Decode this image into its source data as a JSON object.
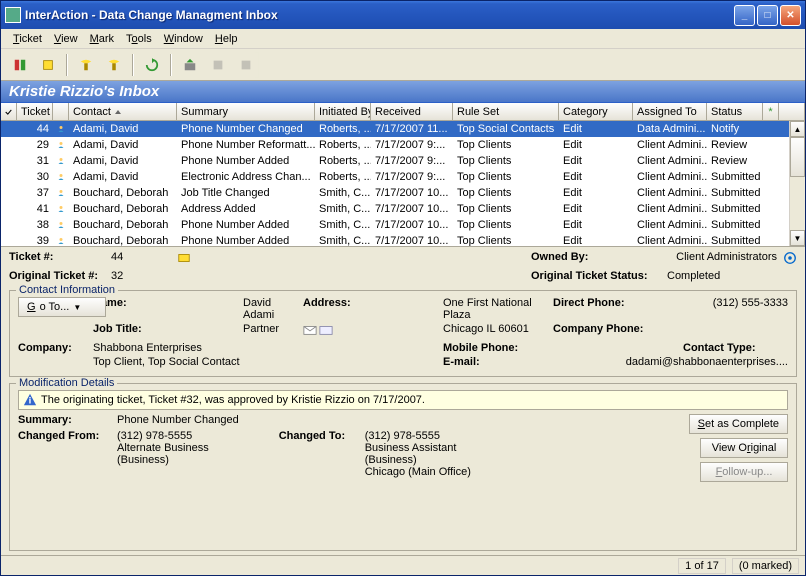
{
  "window": {
    "title": "InterAction - Data Change Managment Inbox"
  },
  "menu": [
    "Ticket",
    "View",
    "Mark",
    "Tools",
    "Window",
    "Help"
  ],
  "inbox_title": "Kristie Rizzio's Inbox",
  "columns": {
    "ticket": "Ticket",
    "contact": "Contact",
    "summary": "Summary",
    "initiated": "Initiated By",
    "received": "Received",
    "ruleset": "Rule Set",
    "category": "Category",
    "assigned": "Assigned To",
    "status": "Status"
  },
  "rows": [
    {
      "n": "44",
      "contact": "Adami, David",
      "summary": "Phone Number Changed",
      "init": "Roberts, ...",
      "recv": "7/17/2007 11...",
      "rule": "Top Social Contacts",
      "cat": "Edit",
      "asgn": "Data Admini...",
      "stat": "Notify",
      "sel": true
    },
    {
      "n": "29",
      "contact": "Adami, David",
      "summary": "Phone Number Reformatt...",
      "init": "Roberts, ...",
      "recv": "7/17/2007 9:...",
      "rule": "Top Clients",
      "cat": "Edit",
      "asgn": "Client Admini...",
      "stat": "Review"
    },
    {
      "n": "31",
      "contact": "Adami, David",
      "summary": "Phone Number Added",
      "init": "Roberts, ...",
      "recv": "7/17/2007 9:...",
      "rule": "Top Clients",
      "cat": "Edit",
      "asgn": "Client Admini...",
      "stat": "Review"
    },
    {
      "n": "30",
      "contact": "Adami, David",
      "summary": "Electronic Address Chan...",
      "init": "Roberts, ...",
      "recv": "7/17/2007 9:...",
      "rule": "Top Clients",
      "cat": "Edit",
      "asgn": "Client Admini...",
      "stat": "Submitted"
    },
    {
      "n": "37",
      "contact": "Bouchard, Deborah",
      "summary": "Job Title Changed",
      "init": "Smith, C...",
      "recv": "7/17/2007 10...",
      "rule": "Top Clients",
      "cat": "Edit",
      "asgn": "Client Admini...",
      "stat": "Submitted"
    },
    {
      "n": "41",
      "contact": "Bouchard, Deborah",
      "summary": "Address Added",
      "init": "Smith, C...",
      "recv": "7/17/2007 10...",
      "rule": "Top Clients",
      "cat": "Edit",
      "asgn": "Client Admini...",
      "stat": "Submitted"
    },
    {
      "n": "38",
      "contact": "Bouchard, Deborah",
      "summary": "Phone Number Added",
      "init": "Smith, C...",
      "recv": "7/17/2007 10...",
      "rule": "Top Clients",
      "cat": "Edit",
      "asgn": "Client Admini...",
      "stat": "Submitted"
    },
    {
      "n": "39",
      "contact": "Bouchard, Deborah",
      "summary": "Phone Number Added",
      "init": "Smith, C...",
      "recv": "7/17/2007 10...",
      "rule": "Top Clients",
      "cat": "Edit",
      "asgn": "Client Admini...",
      "stat": "Submitted"
    }
  ],
  "detail": {
    "labels": {
      "ticket": "Ticket #:",
      "orig": "Original Ticket #:",
      "owned": "Owned By:",
      "origstat": "Original Ticket Status:",
      "name": "Name:",
      "jobtitle": "Job Title:",
      "company": "Company:",
      "ctype": "Contact Type:",
      "addr": "Address:",
      "dphone": "Direct Phone:",
      "cphone": "Company Phone:",
      "mphone": "Mobile Phone:",
      "email": "E-mail:",
      "goto": "Go To..."
    },
    "ticket": "44",
    "orig": "32",
    "owned": "Client Administrators",
    "origstat": "Completed",
    "cinfo_legend": "Contact Information",
    "name": "David Adami",
    "jobtitle": "Partner",
    "company": "Shabbona Enterprises",
    "ctype": "Top Client, Top Social Contact",
    "addr1": "One First National Plaza",
    "addr2": "Chicago IL 60601",
    "dphone": "(312) 555-3333",
    "email": "dadami@shabbonaenterprises....",
    "mod_legend": "Modification Details",
    "mod_msg": "The originating ticket, Ticket #32, was approved by Kristie Rizzio on 7/17/2007.",
    "mod": {
      "summary_l": "Summary:",
      "summary": "Phone Number Changed",
      "from_l": "Changed From:",
      "from1": "(312) 978-5555",
      "from2": "Alternate Business",
      "from3": "(Business)",
      "to_l": "Changed To:",
      "to1": "(312) 978-5555",
      "to2": "Business Assistant",
      "to3": "(Business)",
      "to4": "Chicago (Main Office)"
    },
    "btns": {
      "complete": "Set as Complete",
      "view": "View Original",
      "follow": "Follow-up..."
    }
  },
  "status": {
    "pos": "1 of 17",
    "marked": "(0 marked)"
  }
}
